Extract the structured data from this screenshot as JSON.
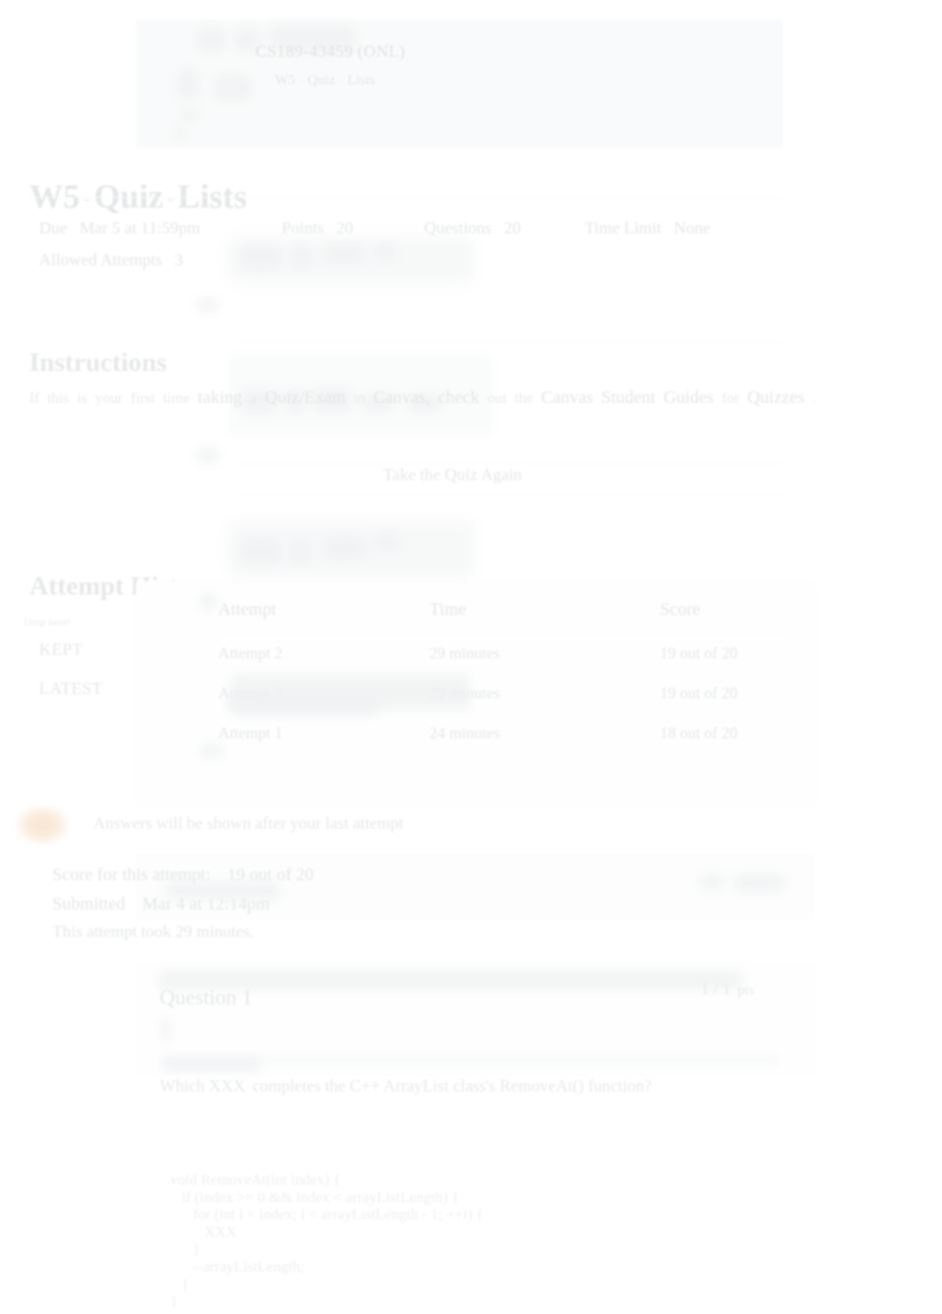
{
  "breadcrumb": {
    "course": "CS189-43459 (ONL)",
    "separator": "-",
    "part1": "W5",
    "part2": "Quiz",
    "part3": "Lists"
  },
  "page_title": {
    "part1": "W5",
    "part2": "Quiz",
    "part3": "Lists",
    "separator": "-"
  },
  "meta": {
    "due_label": "Due",
    "due_value": "Mar 5 at 11:59pm",
    "points_label": "Points",
    "points_value": "20",
    "questions_label": "Questions",
    "questions_value": "20",
    "time_limit_label": "Time Limit",
    "time_limit_value": "None",
    "allowed_attempts_label": "Allowed Attempts",
    "allowed_attempts_value": "3"
  },
  "instructions": {
    "heading": "Instructions",
    "words": [
      "If",
      "this",
      "is",
      "your",
      "first",
      "time",
      "taking",
      "a",
      "Quiz/Exam",
      "in",
      "Canvas,",
      "check",
      "out",
      "the",
      "Canvas",
      "Student",
      "Guides",
      "for",
      "Quizzes",
      "."
    ]
  },
  "actions": {
    "take_quiz_again": "Take the Quiz Again"
  },
  "attempt_history": {
    "heading": "Attempt History",
    "drop_here": "Drop here!",
    "kept_badge": "KEPT",
    "latest_badge": "LATEST",
    "columns": [
      "Attempt",
      "Time",
      "Score"
    ],
    "rows": [
      {
        "attempt": "Attempt 2",
        "time": "29 minutes",
        "score": "19 out of 20"
      },
      {
        "attempt": "Attempt 2",
        "time": "29 minutes",
        "score": "19 out of 20"
      },
      {
        "attempt": "Attempt 1",
        "time": "24 minutes",
        "score": "18 out of 20"
      }
    ]
  },
  "answers_notice": {
    "icon": "warning-icon",
    "text": "Answers will be shown after your last attempt"
  },
  "attempt_summary": {
    "score_label": "Score for this attempt:",
    "score_value": "19 out of 20",
    "submitted_label": "Submitted",
    "submitted_value": "Mar 4 at 12:14pm",
    "duration_text": "This attempt took 29 minutes."
  },
  "question": {
    "title": "Question 1",
    "points": "1 / 1",
    "points_unit": "pts",
    "prompt_part1": "Which XXX",
    "prompt_part2": "completes the C++ ArrayList class's RemoveAt() function?",
    "code": "void RemoveAt(int index) {\n   if (index >= 0 && index < arrayListLength) {\n      for (int i = index; i < arrayListLength - 1; ++i) {\n         XXX\n      }\n      --arrayListLength;\n   }\n}"
  },
  "colors": {
    "band_background": "#eceff0",
    "text_muted": "#a8aeb1",
    "warning_accent": "#e9a45f",
    "card_background": "#fbfcfc"
  }
}
